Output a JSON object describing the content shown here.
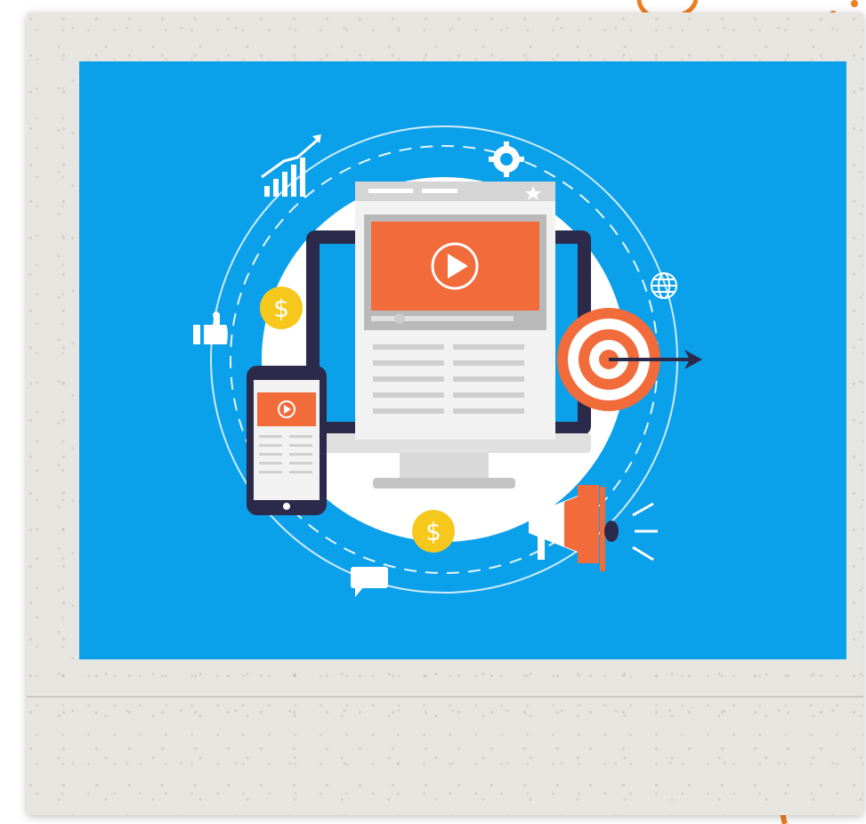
{
  "colors": {
    "sky_blue": "#0ba0ea",
    "paper": "#e7e5df",
    "accent_orange": "#f26b3a",
    "dark_navy": "#2c2a4a",
    "coin_yellow": "#f6c81c",
    "decor_orange": "#ef7e1f"
  },
  "illustration": {
    "coin_symbol": "$",
    "icons": [
      "growth-chart-icon",
      "gear-icon",
      "globe-icon",
      "thumbs-up-icon",
      "dollar-coin-icon",
      "target-icon",
      "megaphone-icon",
      "chat-bubble-icon",
      "play-icon"
    ]
  }
}
